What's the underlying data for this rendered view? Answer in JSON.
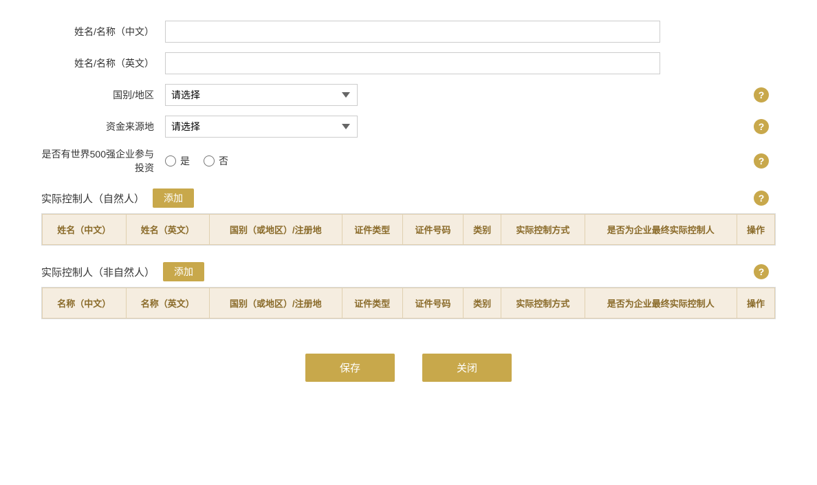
{
  "form": {
    "chinese_name_label": "姓名/名称（中文）",
    "english_name_label": "姓名/名称（英文）",
    "country_label": "国别/地区",
    "country_placeholder": "请选择",
    "fund_source_label": "资金来源地",
    "fund_source_placeholder": "请选择",
    "fortune500_label": "是否有世界500强企业参与投资",
    "yes_label": "是",
    "no_label": "否"
  },
  "natural_person_section": {
    "title": "实际控制人（自然人）",
    "add_button": "添加",
    "columns": [
      "姓名（中文）",
      "姓名（英文）",
      "国别（或地区）/注册地",
      "证件类型",
      "证件号码",
      "类别",
      "实际控制方式",
      "是否为企业最终实际控制人",
      "操作"
    ]
  },
  "non_natural_person_section": {
    "title": "实际控制人（非自然人）",
    "add_button": "添加",
    "columns": [
      "名称（中文）",
      "名称（英文）",
      "国别（或地区）/注册地",
      "证件类型",
      "证件号码",
      "类别",
      "实际控制方式",
      "是否为企业最终实际控制人",
      "操作"
    ]
  },
  "footer": {
    "save_label": "保存",
    "close_label": "关闭"
  },
  "help_icon_char": "?",
  "accent_color": "#c8a84b"
}
